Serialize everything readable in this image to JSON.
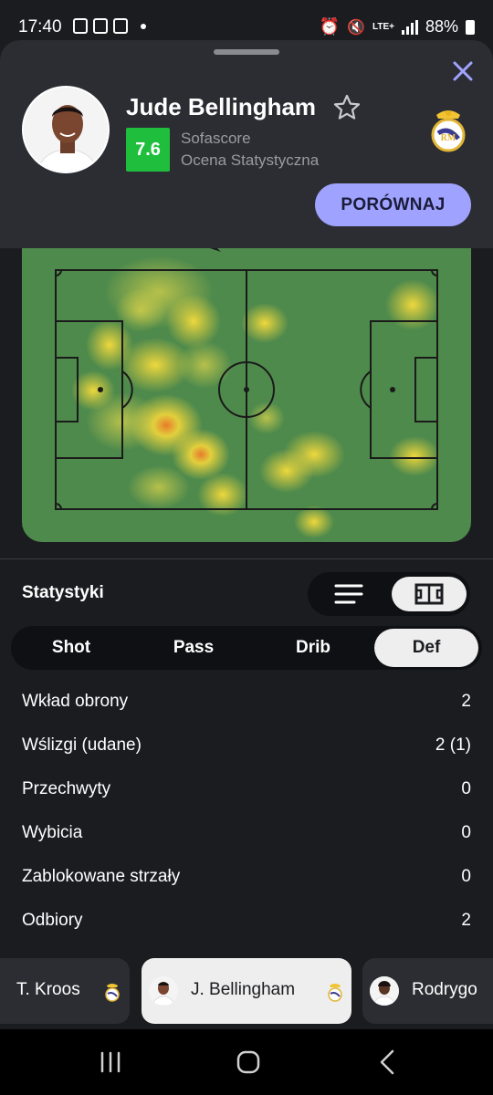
{
  "status_bar": {
    "time": "17:40",
    "network": "LTE+",
    "battery": "88%"
  },
  "player": {
    "name": "Jude Bellingham",
    "rating": "7.6",
    "rating_source": "Sofascore",
    "rating_caption": "Ocena Statystyczna",
    "compare_label": "PORÓWNAJ"
  },
  "colors": {
    "sheet_bg": "#2c2d33",
    "page_bg": "#1b1c20",
    "rating_green": "#1fbf3d",
    "compare_purple": "#9fa3ff",
    "pitch_green": "#4e8a4c",
    "heat_yellow": "#f2d73b",
    "heat_orange": "#f08a2a"
  },
  "stats": {
    "title": "Statystyki",
    "view_modes": [
      "list-icon",
      "pitch-icon"
    ],
    "active_view": "pitch-icon",
    "tabs": [
      {
        "label": "Shot"
      },
      {
        "label": "Pass"
      },
      {
        "label": "Drib"
      },
      {
        "label": "Def"
      }
    ],
    "active_tab": "Def",
    "rows": [
      {
        "label": "Wkład obrony",
        "value": "2"
      },
      {
        "label": "Wślizgi (udane)",
        "value": "2 (1)"
      },
      {
        "label": "Przechwyty",
        "value": "0"
      },
      {
        "label": "Wybicia",
        "value": "0"
      },
      {
        "label": "Zablokowane strzały",
        "value": "0"
      },
      {
        "label": "Odbiory",
        "value": "2"
      }
    ]
  },
  "switcher": {
    "players": [
      {
        "label": "T. Kroos"
      },
      {
        "label": "J. Bellingham"
      },
      {
        "label": "Rodrygo"
      }
    ],
    "active": "J. Bellingham"
  }
}
